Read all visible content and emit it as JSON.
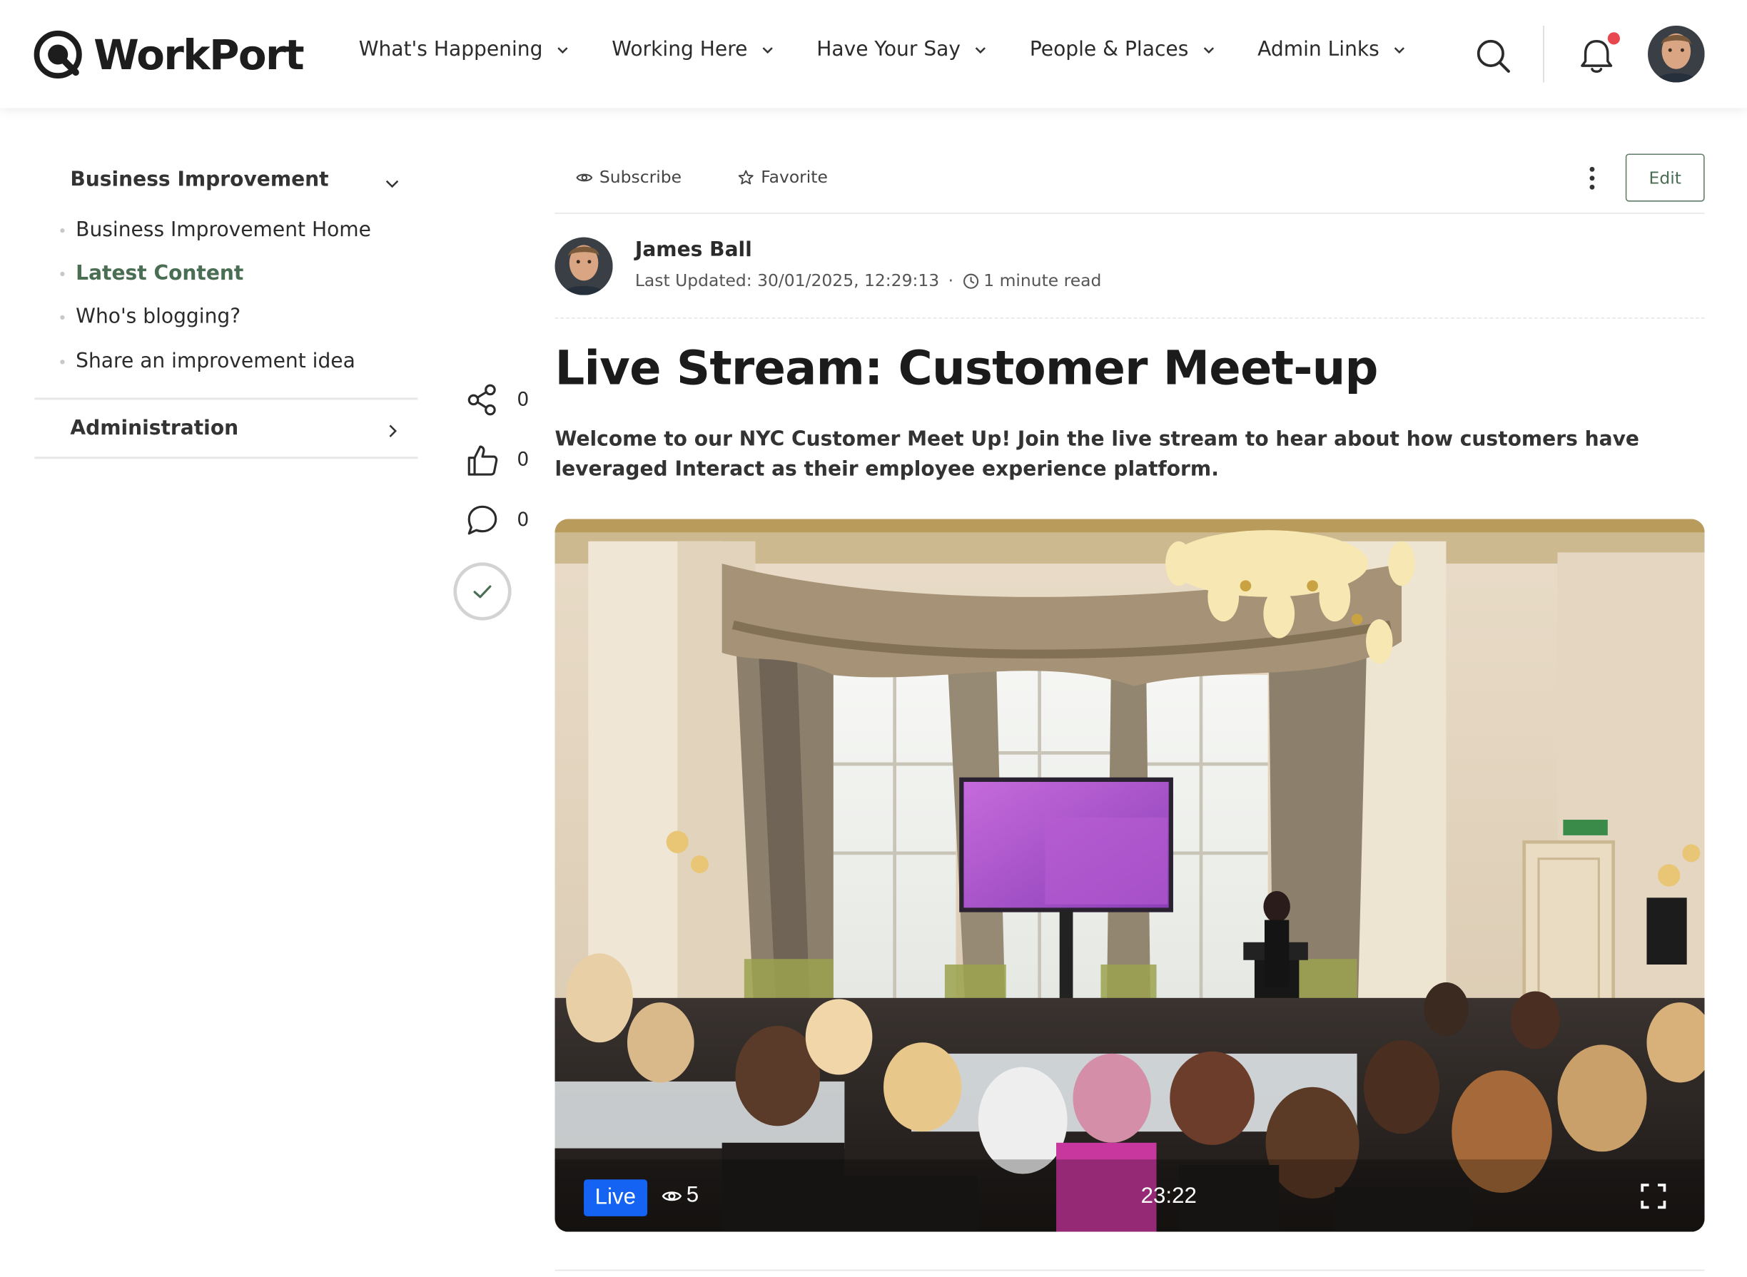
{
  "header": {
    "logo_text": "WorkPort",
    "nav": [
      {
        "label": "What's Happening"
      },
      {
        "label": "Working Here"
      },
      {
        "label": "Have Your Say"
      },
      {
        "label": "People & Places"
      },
      {
        "label": "Admin Links"
      }
    ],
    "icons": [
      "search-icon",
      "bell-icon",
      "avatar"
    ],
    "notification_dot_color": "#e8474f"
  },
  "sidebar": {
    "section_title": "Business Improvement",
    "items": [
      {
        "label": "Business Improvement Home",
        "active": false
      },
      {
        "label": "Latest Content",
        "active": true
      },
      {
        "label": "Who's blogging?",
        "active": false
      },
      {
        "label": "Share an improvement idea",
        "active": false
      }
    ],
    "admin_title": "Administration",
    "active_color": "#4a6e53"
  },
  "actions": {
    "subscribe_label": "Subscribe",
    "favorite_label": "Favorite",
    "edit_label": "Edit"
  },
  "author": {
    "name": "James Ball",
    "last_updated": "Last Updated: 30/01/2025, 12:29:13",
    "separator": "·",
    "read_time": "1 minute read"
  },
  "engagement": {
    "shares": "0",
    "likes": "0",
    "comments": "0"
  },
  "article": {
    "title": "Live Stream: Customer Meet-up",
    "lead": "Welcome to our NYC Customer Meet Up! Join the live stream to hear about how customers have leveraged Interact as their employee experience platform."
  },
  "video": {
    "live_label": "Live",
    "viewer_count": "5",
    "timecode": "23:22",
    "live_color": "#1463f3"
  }
}
